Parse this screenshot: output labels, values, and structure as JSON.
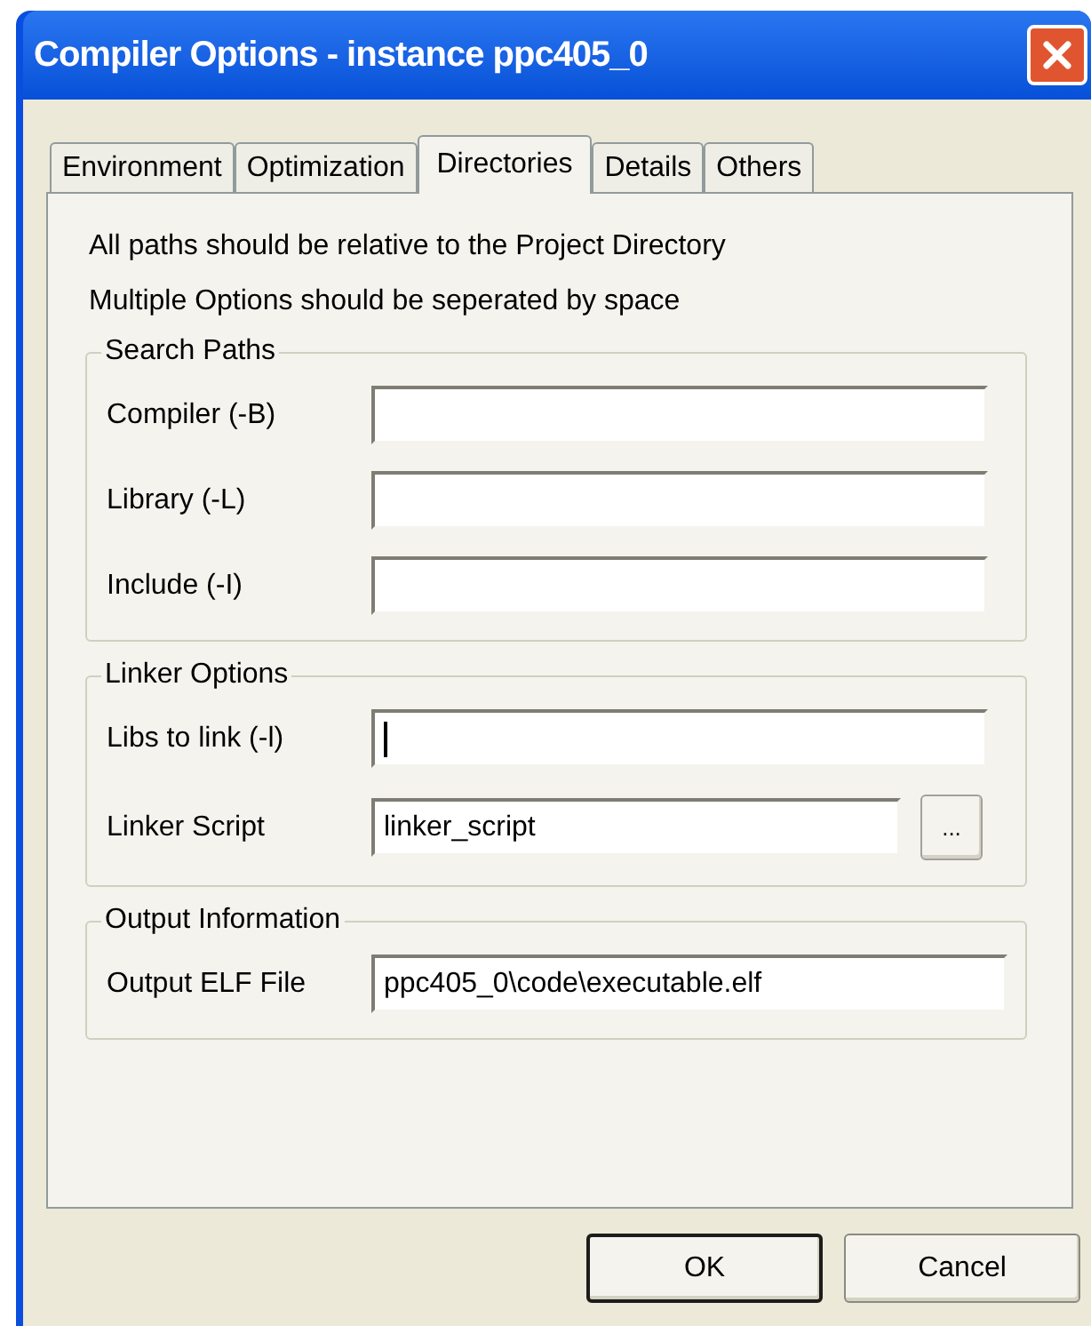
{
  "window": {
    "title": "Compiler Options -  instance ppc405_0"
  },
  "tabs": [
    {
      "label": "Environment",
      "selected": false
    },
    {
      "label": "Optimization",
      "selected": false
    },
    {
      "label": "Directories",
      "selected": true
    },
    {
      "label": "Details",
      "selected": false
    },
    {
      "label": "Others",
      "selected": false
    }
  ],
  "notes": [
    "All paths should be relative to the Project Directory",
    "Multiple Options should be seperated by space"
  ],
  "groups": [
    {
      "title": "Search Paths",
      "fields": [
        {
          "label": "Compiler (-B)",
          "focused": false,
          "browse": false
        },
        {
          "label": "Library (-L)",
          "focused": false,
          "browse": false
        },
        {
          "label": "Include (-I)",
          "focused": false,
          "browse": false
        }
      ]
    },
    {
      "title": "Linker Options",
      "fields": [
        {
          "label": "Libs to link (-l)",
          "focused": true,
          "browse": false
        },
        {
          "label": "Linker Script",
          "value": "linker_script",
          "focused": false,
          "browse": true,
          "browse_label": "..."
        }
      ]
    },
    {
      "title": "Output Information",
      "fields": [
        {
          "label": "Output ELF File",
          "value": "ppc405_0\\code\\executable.elf",
          "focused": false,
          "browse": false
        }
      ]
    }
  ],
  "buttons": [
    {
      "label": "OK",
      "default": true
    },
    {
      "label": "Cancel",
      "default": false
    }
  ]
}
